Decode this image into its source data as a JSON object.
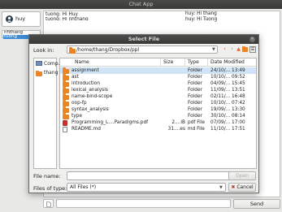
{
  "window": {
    "title": "Chat App"
  },
  "user": {
    "name": "huy"
  },
  "users_list": [
    {
      "name": "nhthang",
      "selected": false
    },
    {
      "name": "tuong",
      "selected": true
    }
  ],
  "chat": {
    "messages_right": [
      "huy: Hi thang",
      "huy: Hi Tuong"
    ],
    "messages_left": [
      "tuong: Hi Huy",
      "tuong: Hi nhthang"
    ]
  },
  "composer": {
    "send_label": "Send",
    "message": ""
  },
  "dialog": {
    "title": "Select File",
    "look_in_label": "Look in:",
    "look_in_path": "/home/thang/Dropbox/ppl",
    "places": [
      {
        "label": "Comp...",
        "icon": "computer-icon"
      },
      {
        "label": "thang",
        "icon": "home-folder-icon"
      }
    ],
    "columns": [
      "Name",
      "Size",
      "Type",
      "Date Modified"
    ],
    "files": [
      {
        "name": "assignment",
        "size": "",
        "type": "Folder",
        "date": "24/10/... 13:49",
        "icon": "folder",
        "selected": true
      },
      {
        "name": "ast",
        "size": "",
        "type": "Folder",
        "date": "10/10/... 09:52",
        "icon": "folder",
        "selected": false
      },
      {
        "name": "introduction",
        "size": "",
        "type": "Folder",
        "date": "04/09/... 15:45",
        "icon": "folder",
        "selected": false
      },
      {
        "name": "lexical_analysis",
        "size": "",
        "type": "Folder",
        "date": "11/09/... 13:51",
        "icon": "folder",
        "selected": false
      },
      {
        "name": "name-bind-scope",
        "size": "",
        "type": "Folder",
        "date": "02/11/... 16:48",
        "icon": "folder",
        "selected": false
      },
      {
        "name": "oop-fp",
        "size": "",
        "type": "Folder",
        "date": "10/10/... 07:42",
        "icon": "folder",
        "selected": false
      },
      {
        "name": "syntax_analysis",
        "size": "",
        "type": "Folder",
        "date": "19/09/... 13:30",
        "icon": "folder",
        "selected": false
      },
      {
        "name": "type",
        "size": "",
        "type": "Folder",
        "date": "30/10/... 08:14",
        "icon": "folder",
        "selected": false
      },
      {
        "name": "Programming_L....Paradigms.pdf",
        "size": "2....iB",
        "type": "pdf File",
        "date": "07/09/... 17:00",
        "icon": "pdf",
        "selected": false
      },
      {
        "name": "README.md",
        "size": "31....es",
        "type": "md File",
        "date": "11/10/... 17:51",
        "icon": "doc",
        "selected": false
      }
    ],
    "file_name_label": "File name:",
    "file_name_value": "",
    "files_of_type_label": "Files of type:",
    "files_of_type_value": "All Files (*)",
    "open_label": "Open",
    "cancel_label": "Cancel"
  },
  "colors": {
    "selection": "#3d8bd6",
    "folder": "#e98427",
    "nav_accent": "#e2642c"
  }
}
